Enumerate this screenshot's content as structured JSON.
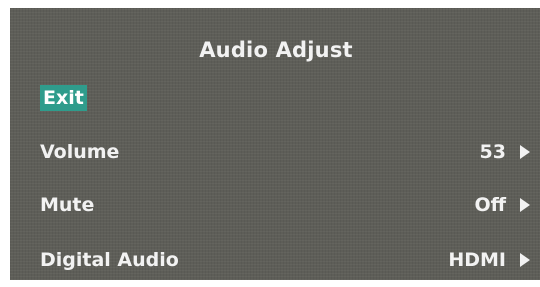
{
  "menu": {
    "title": "Audio Adjust",
    "items": [
      {
        "label": "Exit",
        "value": null,
        "selected": true
      },
      {
        "label": "Volume",
        "value": "53",
        "icon": "right-arrow-icon"
      },
      {
        "label": "Mute",
        "value": "Off",
        "icon": "right-arrow-icon"
      },
      {
        "label": "Digital Audio",
        "value": "HDMI",
        "icon": "right-arrow-icon"
      }
    ]
  },
  "colors": {
    "panel": "#5e5e58",
    "text": "#f2f2f2",
    "selection": "#2f9c8c"
  }
}
